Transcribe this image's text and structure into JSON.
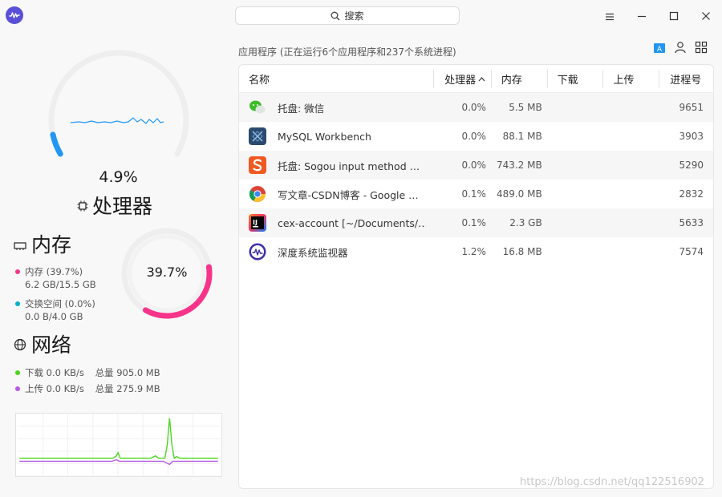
{
  "titlebar": {
    "search_label": "搜索"
  },
  "cpu": {
    "percent_label": "4.9%",
    "usage": 0.049,
    "title": "处理器"
  },
  "memory": {
    "title": "内存",
    "percent_label": "39.7%",
    "usage": 0.397,
    "mem_label": "内存 (39.7%)",
    "mem_value": "6.2 GB/15.5 GB",
    "swap_label": "交换空间 (0.0%)",
    "swap_value": "0.0 B/4.0 GB"
  },
  "network": {
    "title": "网络",
    "download_label": "下载 0.0 KB/s",
    "download_total": "总量 905.0 MB",
    "upload_label": "上传 0.0 KB/s",
    "upload_total": "总量 275.9 MB"
  },
  "processes": {
    "header": "应用程序 (正在运行6个应用程序和237个系统进程)",
    "columns": {
      "name": "名称",
      "cpu": "处理器",
      "memory": "内存",
      "download": "下载",
      "upload": "上传",
      "pid": "进程号"
    },
    "rows": [
      {
        "name": "托盘: 微信",
        "cpu": "0.0%",
        "mem": "5.5 MB",
        "pid": "9651",
        "icon": "wechat-icon"
      },
      {
        "name": "MySQL Workbench",
        "cpu": "0.0%",
        "mem": "88.1 MB",
        "pid": "3903",
        "icon": "mysql-workbench-icon"
      },
      {
        "name": "托盘: Sogou input method  …",
        "cpu": "0.0%",
        "mem": "743.2 MB",
        "pid": "5290",
        "icon": "sogou-icon"
      },
      {
        "name": "写文章-CSDN博客 - Google …",
        "cpu": "0.1%",
        "mem": "489.0 MB",
        "pid": "2832",
        "icon": "chrome-icon"
      },
      {
        "name": "cex-account [~/Documents/…",
        "cpu": "0.1%",
        "mem": "2.3 GB",
        "pid": "5633",
        "icon": "intellij-icon"
      },
      {
        "name": "深度系统监视器",
        "cpu": "1.2%",
        "mem": "16.8 MB",
        "pid": "7574",
        "icon": "system-monitor-icon"
      }
    ]
  },
  "watermark": "https://blog.csdn.net/qq122516902",
  "colors": {
    "cpu_ring": "#2196f3",
    "mem_ring": "#f7348a",
    "swap": "#00b2c8",
    "download": "#4ad51d",
    "upload": "#b45ae4",
    "logo": "#5a4fd8"
  }
}
